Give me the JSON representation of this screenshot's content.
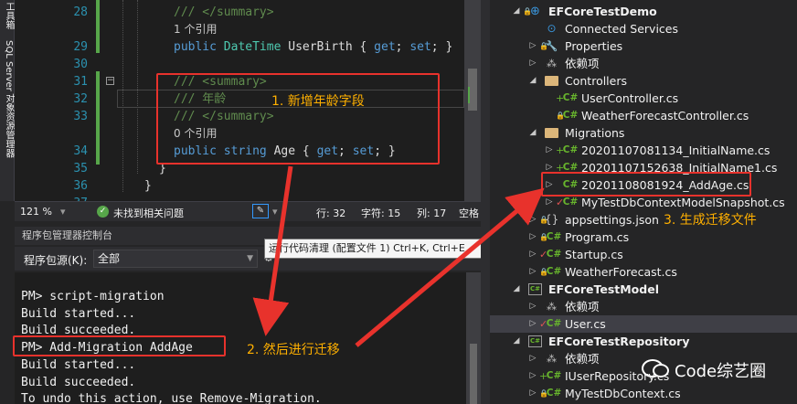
{
  "side_tabs": [
    "工具箱",
    "SQL Server 对象资源管理器"
  ],
  "editor": {
    "lines": [
      {
        "num": "28",
        "code": "/// </summary>",
        "kind": "doc"
      },
      {
        "num": "",
        "code": "1 个引用",
        "kind": "ref"
      },
      {
        "num": "29",
        "code": "public DateTime UserBirth { get; set; }",
        "kind": "code"
      },
      {
        "num": "30",
        "code": "",
        "kind": "code"
      },
      {
        "num": "31",
        "code": "/// <summary>",
        "kind": "doc"
      },
      {
        "num": "32",
        "code": "/// 年龄",
        "kind": "doc"
      },
      {
        "num": "33",
        "code": "/// </summary>",
        "kind": "doc"
      },
      {
        "num": "",
        "code": "0 个引用",
        "kind": "ref"
      },
      {
        "num": "34",
        "code": "public string Age { get; set; }",
        "kind": "code"
      },
      {
        "num": "35",
        "code": "}",
        "kind": "code"
      },
      {
        "num": "36",
        "code": "}",
        "kind": "code"
      },
      {
        "num": "37",
        "code": "",
        "kind": "code"
      }
    ],
    "status": {
      "zoom": "121 %",
      "issues": "未找到相关问题",
      "row": "行: 32",
      "col_char": "字符: 15",
      "col": "列: 17",
      "mode": "空格"
    }
  },
  "tooltip": "运行代码清理 (配置文件 1) Ctrl+K, Ctrl+E",
  "pmc": {
    "title": "程序包管理器控制台",
    "source_label": "程序包源(K):",
    "source_value": "全部",
    "lines": [
      "PM> script-migration",
      "Build started...",
      "Build succeeded.",
      "PM> Add-Migration AddAge",
      "Build started...",
      "Build succeeded.",
      "To undo this action, use Remove-Migration."
    ]
  },
  "solution": {
    "rows": [
      {
        "label": "EFCoreTestDemo",
        "arrow": "open",
        "icon": "proj-web",
        "mod": "lock"
      },
      {
        "label": "Connected Services",
        "arrow": "",
        "icon": "conn",
        "mod": ""
      },
      {
        "label": "Properties",
        "arrow": "closed",
        "icon": "wrench",
        "mod": "lock"
      },
      {
        "label": "依赖项",
        "arrow": "closed",
        "icon": "dep",
        "mod": ""
      },
      {
        "label": "Controllers",
        "arrow": "open",
        "icon": "folder",
        "mod": ""
      },
      {
        "label": "UserController.cs",
        "arrow": "",
        "icon": "cs",
        "mod": "plus"
      },
      {
        "label": "WeatherForecastController.cs",
        "arrow": "",
        "icon": "cs",
        "mod": "lock"
      },
      {
        "label": "Migrations",
        "arrow": "open",
        "icon": "folder",
        "mod": ""
      },
      {
        "label": "20201107081134_InitialName.cs",
        "arrow": "closed",
        "icon": "cs",
        "mod": "plus"
      },
      {
        "label": "20201107152638_InitialName1.cs",
        "arrow": "closed",
        "icon": "cs",
        "mod": "plus"
      },
      {
        "label": "20201108081924_AddAge.cs",
        "arrow": "closed",
        "icon": "cs",
        "mod": ""
      },
      {
        "label": "MyTestDbContextModelSnapshot.cs",
        "arrow": "closed",
        "icon": "cs",
        "mod": "chk"
      },
      {
        "label": "appsettings.json",
        "arrow": "closed",
        "icon": "json",
        "mod": "lock"
      },
      {
        "label": "Program.cs",
        "arrow": "closed",
        "icon": "cs",
        "mod": "lock"
      },
      {
        "label": "Startup.cs",
        "arrow": "closed",
        "icon": "cs",
        "mod": "chk"
      },
      {
        "label": "WeatherForecast.cs",
        "arrow": "closed",
        "icon": "cs",
        "mod": "lock"
      },
      {
        "label": "EFCoreTestModel",
        "arrow": "open",
        "icon": "proj",
        "mod": ""
      },
      {
        "label": "依赖项",
        "arrow": "closed",
        "icon": "dep",
        "mod": ""
      },
      {
        "label": "User.cs",
        "arrow": "closed",
        "icon": "cs",
        "mod": "chk"
      },
      {
        "label": "EFCoreTestRepository",
        "arrow": "open",
        "icon": "proj",
        "mod": ""
      },
      {
        "label": "依赖项",
        "arrow": "closed",
        "icon": "dep",
        "mod": ""
      },
      {
        "label": "IUserRepository.cs",
        "arrow": "closed",
        "icon": "cs",
        "mod": "plus"
      },
      {
        "label": "MyTestDbContext.cs",
        "arrow": "closed",
        "icon": "cs",
        "mod": "lock"
      }
    ]
  },
  "annotations": {
    "step1": "1. 新增年龄字段",
    "step2": "2. 然后进行迁移",
    "step3": "3. 生成迁移文件",
    "accent": "#e8322c",
    "text_color": "#ffb000"
  },
  "watermark": "Code综艺圈"
}
